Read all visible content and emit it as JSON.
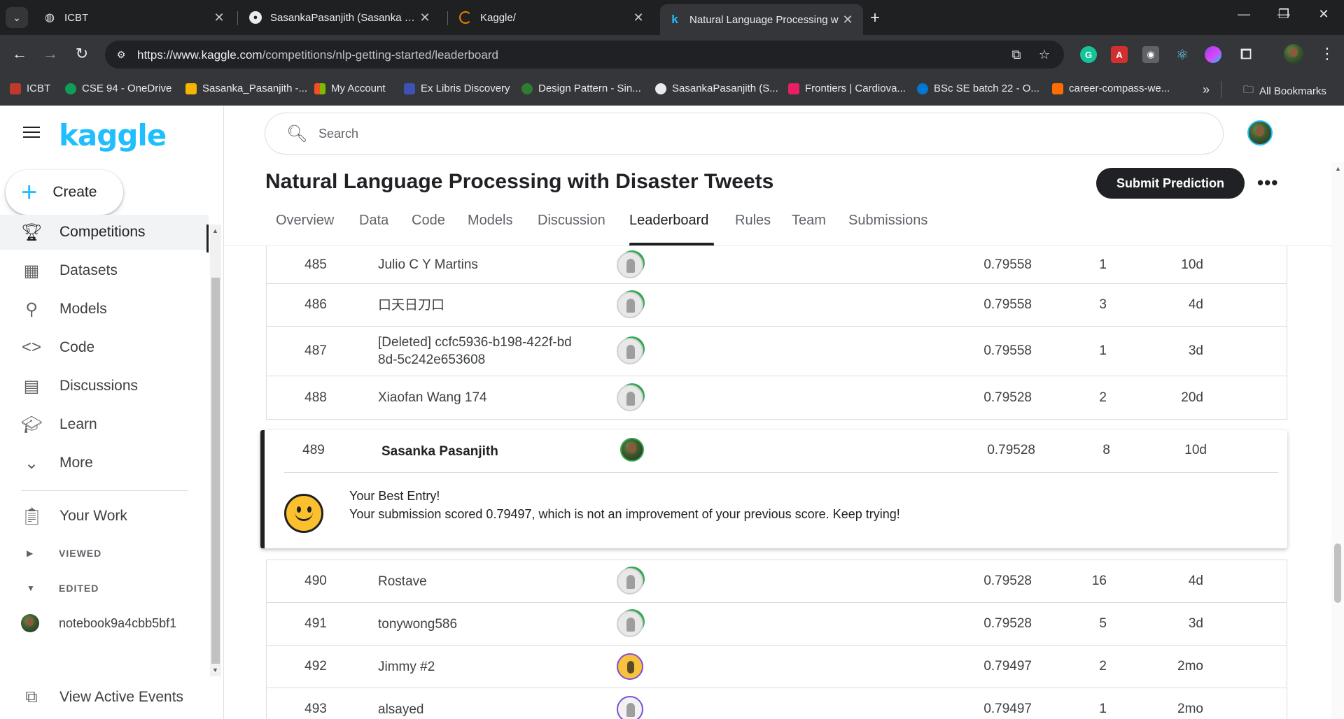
{
  "browser": {
    "tabs": [
      {
        "title": "ICBT",
        "favicon": "globe-icon"
      },
      {
        "title": "SasankaPasanjith (Sasanka Pasa",
        "favicon": "github-icon"
      },
      {
        "title": "Kaggle/",
        "favicon": "kaggle-loading-icon"
      },
      {
        "title": "Natural Language Processing w",
        "favicon": "kaggle-icon"
      }
    ],
    "url_host": "https://www.kaggle.com",
    "url_path": "/competitions/nlp-getting-started/leaderboard",
    "bookmarks": [
      {
        "label": "ICBT",
        "color": "#c0392b"
      },
      {
        "label": "CSE 94 - OneDrive",
        "color": "#0f9d58"
      },
      {
        "label": "Sasanka_Pasanjith -...",
        "color": "#f4b400"
      },
      {
        "label": "My Account",
        "color": "#f25022"
      },
      {
        "label": "Ex Libris Discovery",
        "color": "#3f51b5"
      },
      {
        "label": "Design Pattern - Sin...",
        "color": "#2e7d32"
      },
      {
        "label": "SasankaPasanjith (S...",
        "color": "#e8eaed"
      },
      {
        "label": "Frontiers | Cardiova...",
        "color": "#e91e63"
      },
      {
        "label": "BSc SE batch 22 - O...",
        "color": "#0078d4"
      },
      {
        "label": "career-compass-we...",
        "color": "#ff6d00"
      }
    ],
    "all_bookmarks": "All Bookmarks"
  },
  "sidebar": {
    "logo": "kaggle",
    "create_label": "Create",
    "items": [
      {
        "label": "Competitions",
        "icon": "trophy-icon"
      },
      {
        "label": "Datasets",
        "icon": "table-icon"
      },
      {
        "label": "Models",
        "icon": "models-icon"
      },
      {
        "label": "Code",
        "icon": "code-icon"
      },
      {
        "label": "Discussions",
        "icon": "comment-icon"
      },
      {
        "label": "Learn",
        "icon": "school-icon"
      },
      {
        "label": "More",
        "icon": "chevron-down-icon"
      }
    ],
    "your_work": "Your Work",
    "viewed": "VIEWED",
    "edited": "EDITED",
    "notebook": "notebook9a4cbb5bf1",
    "view_active_events": "View Active Events"
  },
  "header": {
    "search_placeholder": "Search"
  },
  "competition": {
    "title": "Natural Language Processing with Disaster Tweets",
    "submit_label": "Submit Prediction",
    "tabs": [
      "Overview",
      "Data",
      "Code",
      "Models",
      "Discussion",
      "Leaderboard",
      "Rules",
      "Team",
      "Submissions"
    ],
    "active_tab": "Leaderboard"
  },
  "leaderboard": {
    "rows": [
      {
        "rank": "485",
        "name": "Julio C Y Martins",
        "name2": "",
        "score": "0.79558",
        "entries": "1",
        "last": "10d"
      },
      {
        "rank": "486",
        "name": "口天日刀口",
        "name2": "",
        "score": "0.79558",
        "entries": "3",
        "last": "4d"
      },
      {
        "rank": "487",
        "name": "[Deleted] ccfc5936-b198-422f-bd",
        "name2": "8d-5c242e653608",
        "score": "0.79558",
        "entries": "1",
        "last": "3d"
      },
      {
        "rank": "488",
        "name": "Xiaofan Wang 174",
        "name2": "",
        "score": "0.79528",
        "entries": "2",
        "last": "20d"
      },
      {
        "rank": "490",
        "name": "Rostave",
        "name2": "",
        "score": "0.79528",
        "entries": "16",
        "last": "4d"
      },
      {
        "rank": "491",
        "name": "tonywong586",
        "name2": "",
        "score": "0.79528",
        "entries": "5",
        "last": "3d"
      },
      {
        "rank": "492",
        "name": "Jimmy #2",
        "name2": "",
        "score": "0.79497",
        "entries": "2",
        "last": "2mo"
      },
      {
        "rank": "493",
        "name": "alsayed",
        "name2": "",
        "score": "0.79497",
        "entries": "1",
        "last": "2mo"
      }
    ],
    "best": {
      "rank": "489",
      "name": "Sasanka Pasanjith",
      "score": "0.79528",
      "entries": "8",
      "last": "10d",
      "title": "Your Best Entry!",
      "message": "Your submission scored 0.79497, which is not an improvement of your previous score. Keep trying!"
    }
  }
}
